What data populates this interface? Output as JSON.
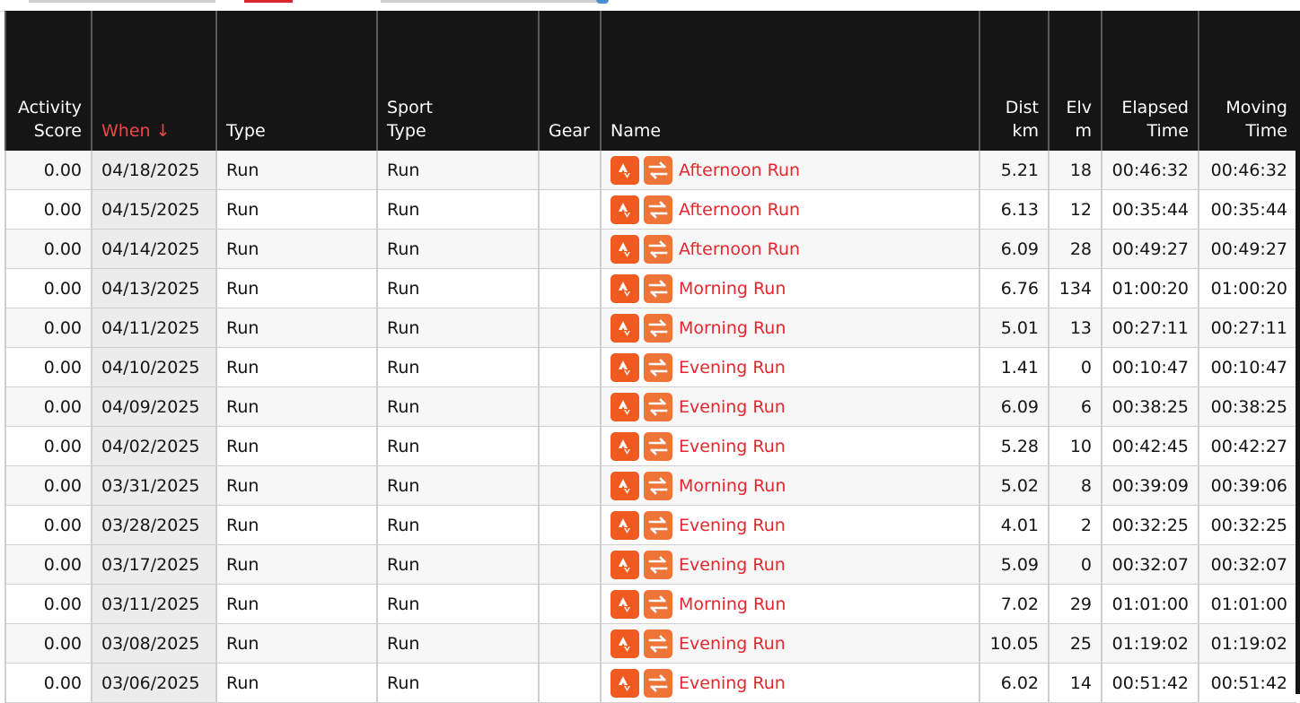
{
  "columns": {
    "activity_score": [
      "Activity",
      "Score"
    ],
    "when": "When ↓",
    "type": "Type",
    "sport_type": [
      "Sport",
      "Type"
    ],
    "gear": "Gear",
    "name": "Name",
    "dist": [
      "Dist",
      "km"
    ],
    "elv": [
      "Elv",
      "m"
    ],
    "elapsed": [
      "Elapsed",
      "Time"
    ],
    "moving": [
      "Moving",
      "Time"
    ]
  },
  "icons": {
    "source": "strava-icon",
    "sync": "sync-arrows-icon"
  },
  "colors": {
    "link": "#e8262e",
    "header_bg": "#151515",
    "sorted_header": "#f0454b",
    "strava": "#f05a20"
  },
  "rows": [
    {
      "score": "0.00",
      "when": "04/18/2025",
      "type": "Run",
      "sport": "Run",
      "gear": "",
      "name": "Afternoon Run",
      "dist": "5.21",
      "elv": "18",
      "elapsed": "00:46:32",
      "moving": "00:46:32"
    },
    {
      "score": "0.00",
      "when": "04/15/2025",
      "type": "Run",
      "sport": "Run",
      "gear": "",
      "name": "Afternoon Run",
      "dist": "6.13",
      "elv": "12",
      "elapsed": "00:35:44",
      "moving": "00:35:44"
    },
    {
      "score": "0.00",
      "when": "04/14/2025",
      "type": "Run",
      "sport": "Run",
      "gear": "",
      "name": "Afternoon Run",
      "dist": "6.09",
      "elv": "28",
      "elapsed": "00:49:27",
      "moving": "00:49:27"
    },
    {
      "score": "0.00",
      "when": "04/13/2025",
      "type": "Run",
      "sport": "Run",
      "gear": "",
      "name": "Morning Run",
      "dist": "6.76",
      "elv": "134",
      "elapsed": "01:00:20",
      "moving": "01:00:20"
    },
    {
      "score": "0.00",
      "when": "04/11/2025",
      "type": "Run",
      "sport": "Run",
      "gear": "",
      "name": "Morning Run",
      "dist": "5.01",
      "elv": "13",
      "elapsed": "00:27:11",
      "moving": "00:27:11"
    },
    {
      "score": "0.00",
      "when": "04/10/2025",
      "type": "Run",
      "sport": "Run",
      "gear": "",
      "name": "Evening Run",
      "dist": "1.41",
      "elv": "0",
      "elapsed": "00:10:47",
      "moving": "00:10:47"
    },
    {
      "score": "0.00",
      "when": "04/09/2025",
      "type": "Run",
      "sport": "Run",
      "gear": "",
      "name": "Evening Run",
      "dist": "6.09",
      "elv": "6",
      "elapsed": "00:38:25",
      "moving": "00:38:25"
    },
    {
      "score": "0.00",
      "when": "04/02/2025",
      "type": "Run",
      "sport": "Run",
      "gear": "",
      "name": "Evening Run",
      "dist": "5.28",
      "elv": "10",
      "elapsed": "00:42:45",
      "moving": "00:42:27"
    },
    {
      "score": "0.00",
      "when": "03/31/2025",
      "type": "Run",
      "sport": "Run",
      "gear": "",
      "name": "Morning Run",
      "dist": "5.02",
      "elv": "8",
      "elapsed": "00:39:09",
      "moving": "00:39:06"
    },
    {
      "score": "0.00",
      "when": "03/28/2025",
      "type": "Run",
      "sport": "Run",
      "gear": "",
      "name": "Evening Run",
      "dist": "4.01",
      "elv": "2",
      "elapsed": "00:32:25",
      "moving": "00:32:25"
    },
    {
      "score": "0.00",
      "when": "03/17/2025",
      "type": "Run",
      "sport": "Run",
      "gear": "",
      "name": "Evening Run",
      "dist": "5.09",
      "elv": "0",
      "elapsed": "00:32:07",
      "moving": "00:32:07"
    },
    {
      "score": "0.00",
      "when": "03/11/2025",
      "type": "Run",
      "sport": "Run",
      "gear": "",
      "name": "Morning Run",
      "dist": "7.02",
      "elv": "29",
      "elapsed": "01:01:00",
      "moving": "01:01:00"
    },
    {
      "score": "0.00",
      "when": "03/08/2025",
      "type": "Run",
      "sport": "Run",
      "gear": "",
      "name": "Evening Run",
      "dist": "10.05",
      "elv": "25",
      "elapsed": "01:19:02",
      "moving": "01:19:02"
    },
    {
      "score": "0.00",
      "when": "03/06/2025",
      "type": "Run",
      "sport": "Run",
      "gear": "",
      "name": "Evening Run",
      "dist": "6.02",
      "elv": "14",
      "elapsed": "00:51:42",
      "moving": "00:51:42"
    }
  ]
}
